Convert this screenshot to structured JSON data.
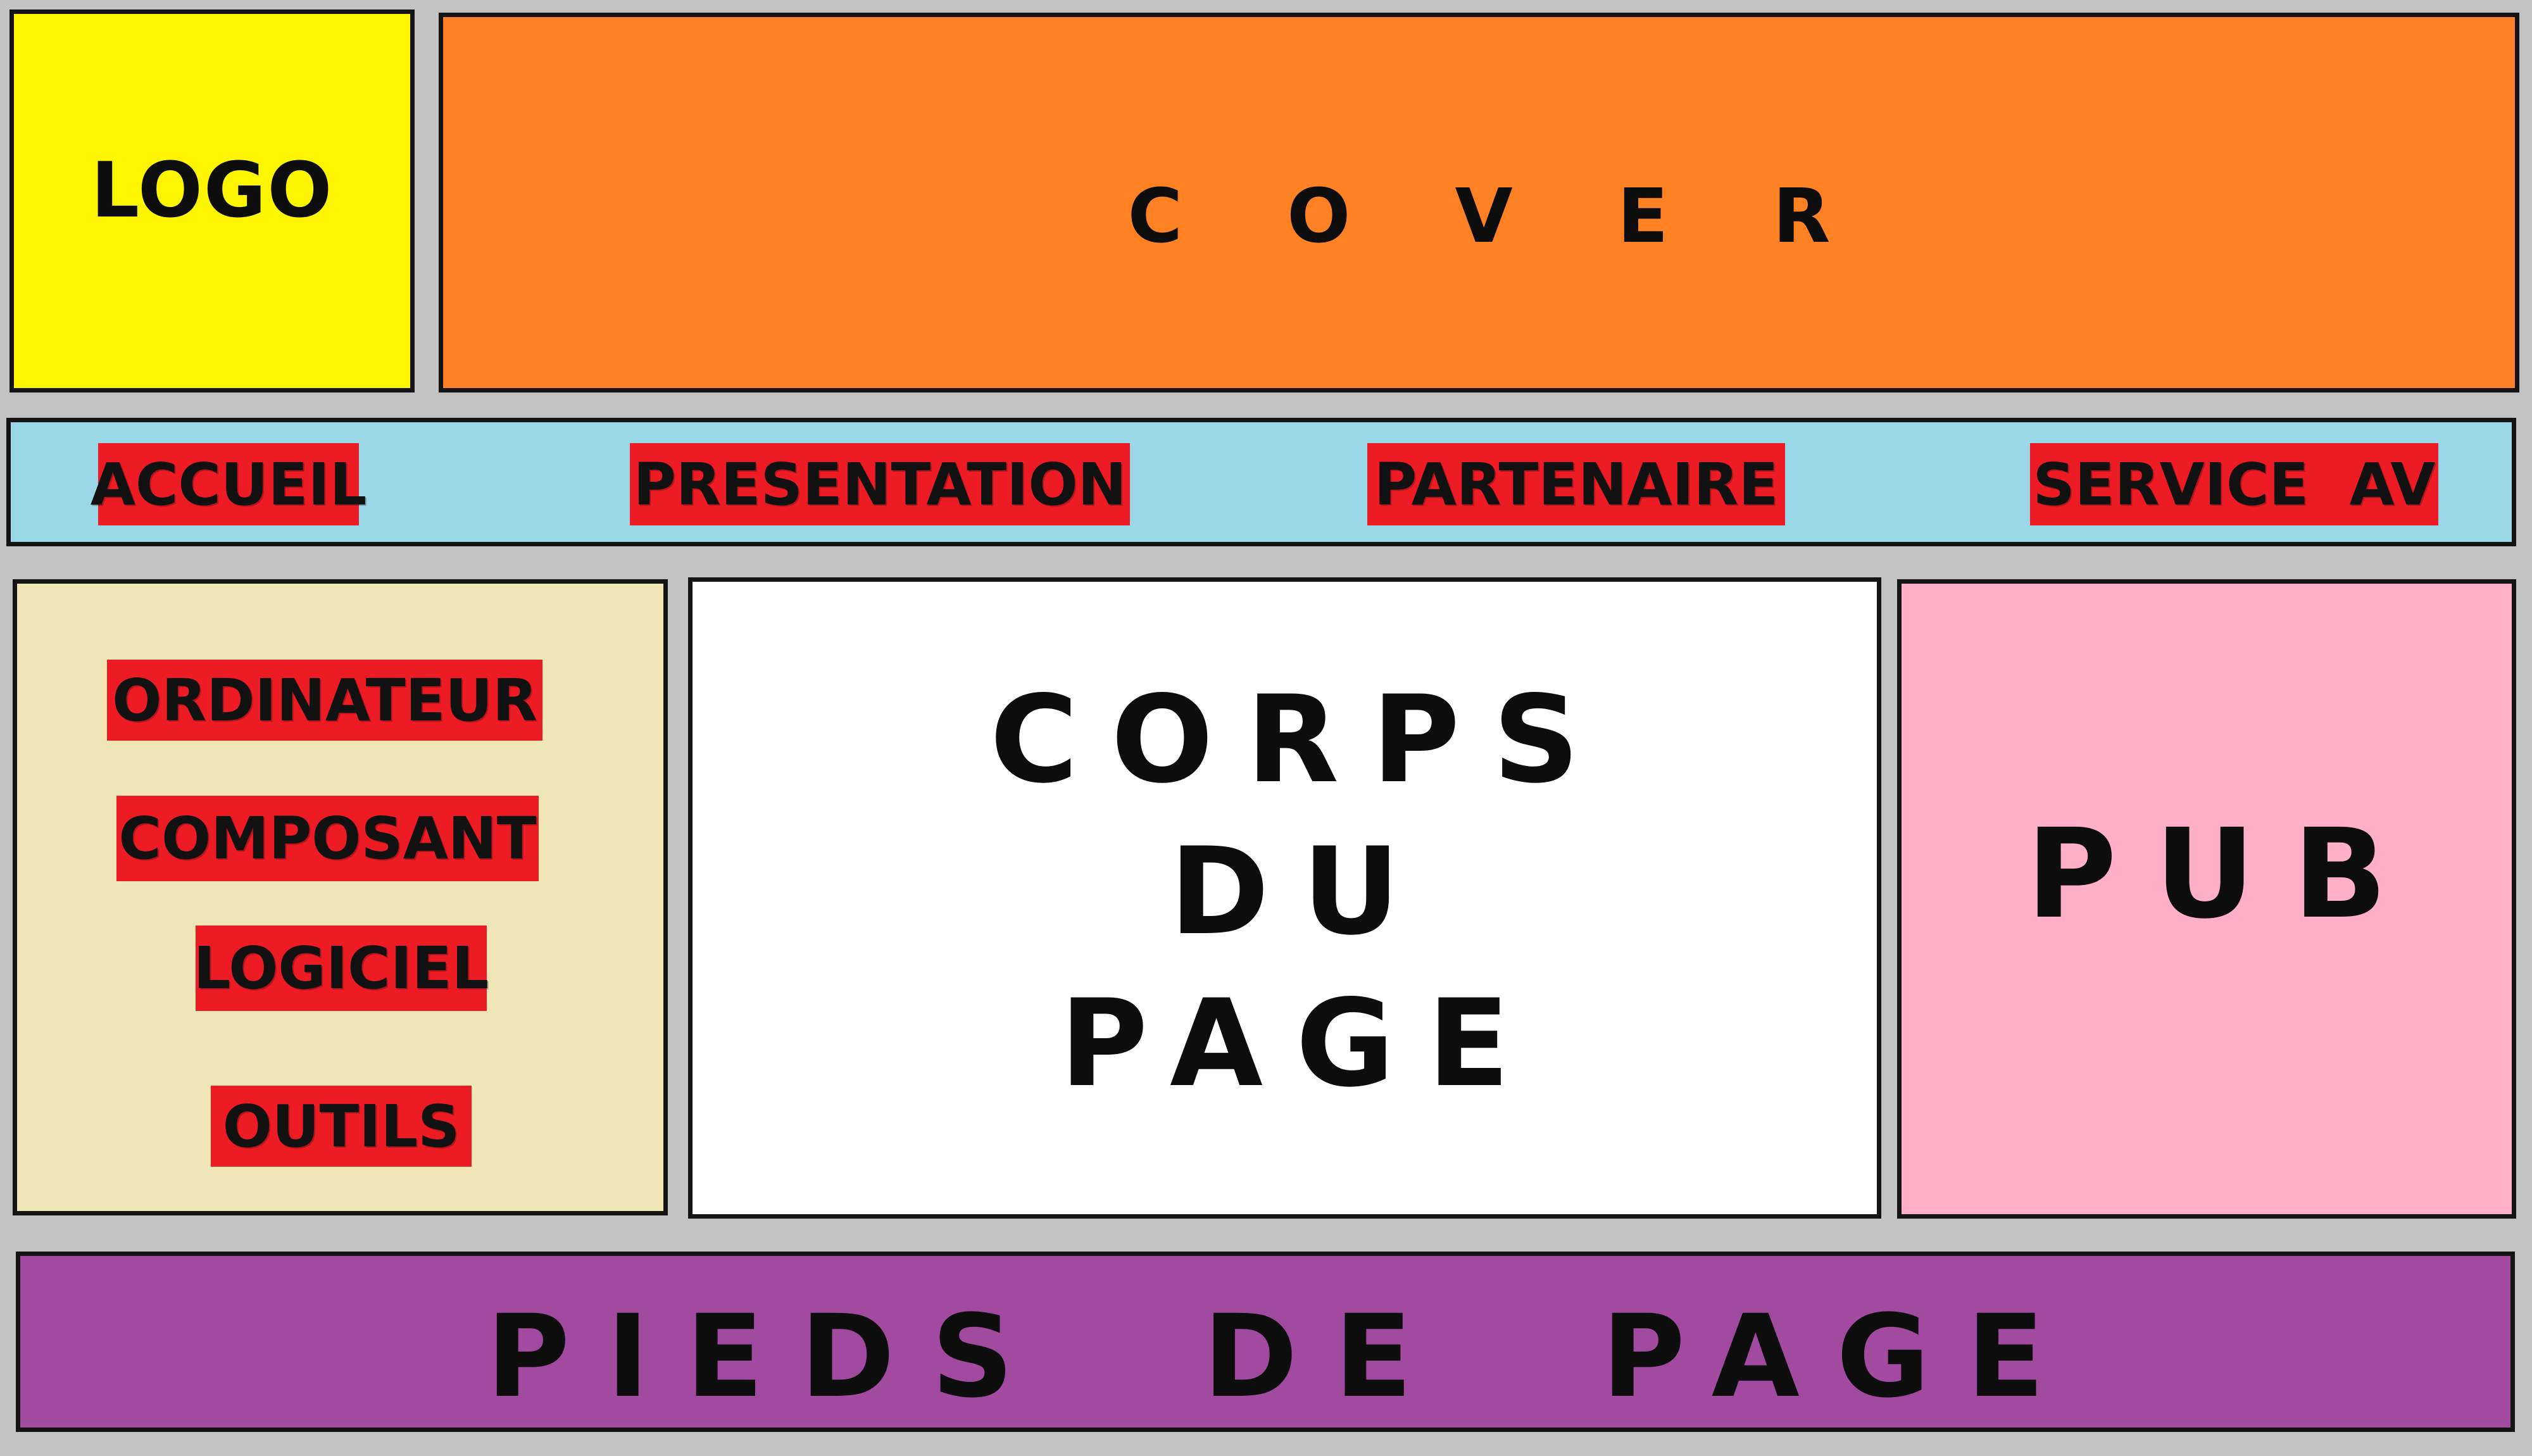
{
  "logo": {
    "label": "LOGO"
  },
  "cover": {
    "label": "C O V E R"
  },
  "nav": {
    "items": [
      {
        "label": "ACCUEIL"
      },
      {
        "label": "PRESENTATION"
      },
      {
        "label": "PARTENAIRE"
      },
      {
        "label": "SERVICE  AV"
      }
    ]
  },
  "sidebar": {
    "items": [
      {
        "label": "ORDINATEUR"
      },
      {
        "label": "COMPOSANT"
      },
      {
        "label": "LOGICIEL"
      },
      {
        "label": "OUTILS"
      }
    ]
  },
  "main": {
    "line1": "CORPS",
    "line2": "DU",
    "line3": "PAGE"
  },
  "pub": {
    "label": "PUB"
  },
  "footer": {
    "label": "PIEDS  DE  PAGE"
  },
  "colors": {
    "background": "#c3c3c3",
    "logo": "#fef600",
    "cover": "#fe8124",
    "nav": "#9bd8e7",
    "tag": "#ed1c24",
    "sidebar": "#f0e5b5",
    "main": "#ffffff",
    "pub": "#ffafc8",
    "footer": "#a14a9f"
  }
}
